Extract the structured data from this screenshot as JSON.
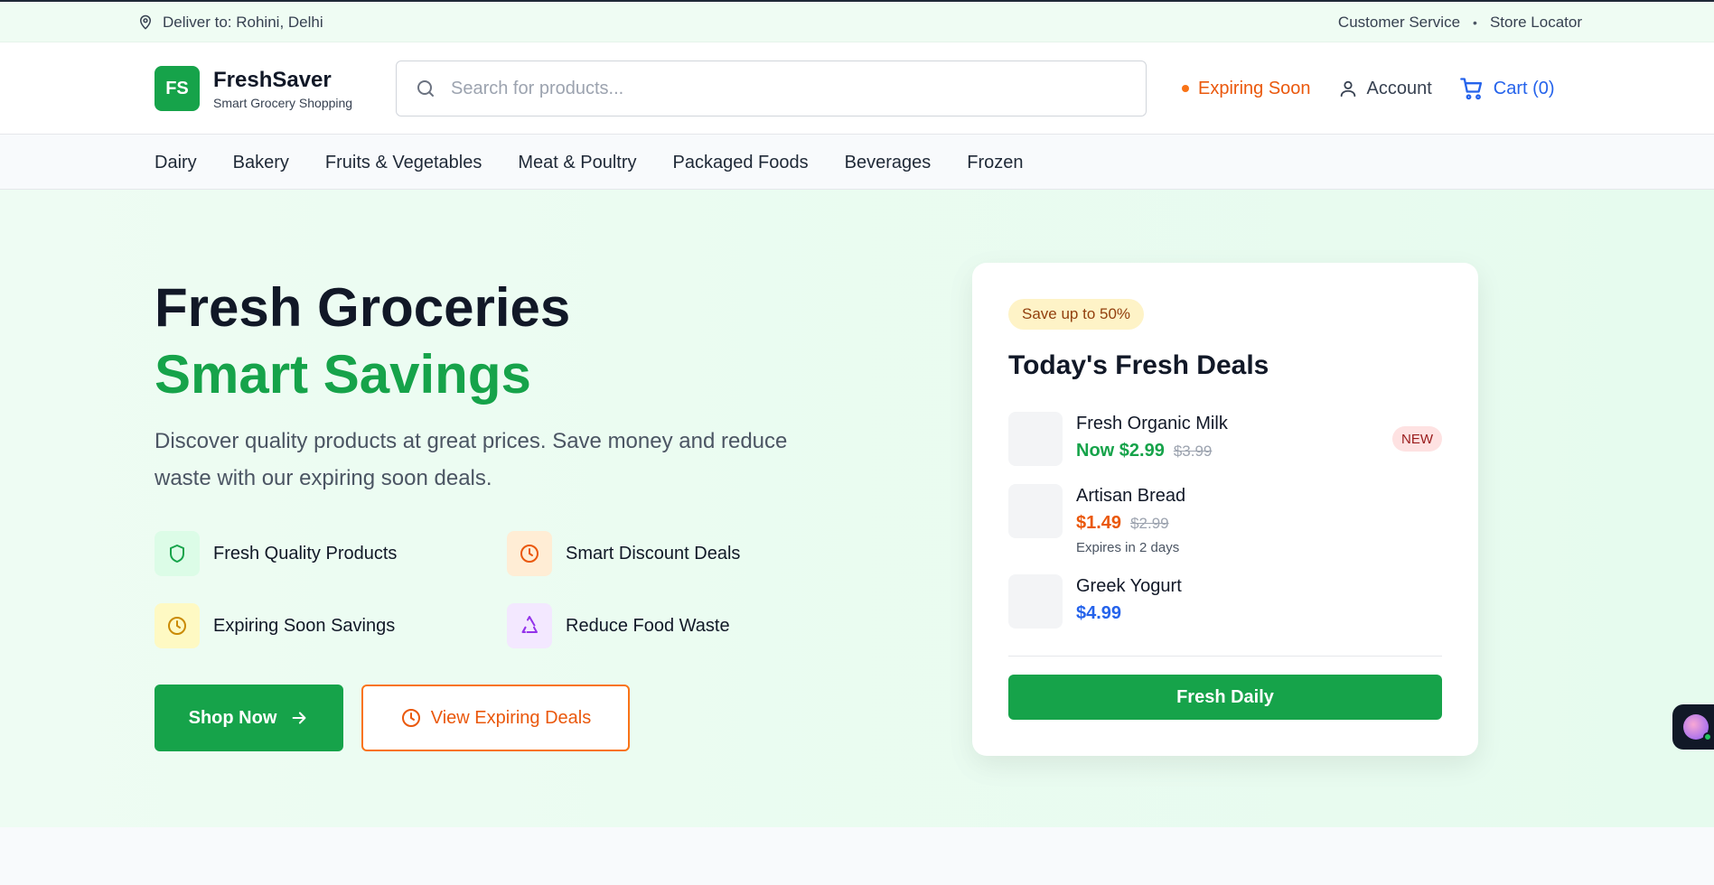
{
  "topbar": {
    "deliver_text": "Deliver to: Rohini, Delhi",
    "links": [
      "Customer Service",
      "Store Locator"
    ],
    "separator": "•"
  },
  "header": {
    "logo_initials": "FS",
    "brand_name": "FreshSaver",
    "brand_tagline": "Smart Grocery Shopping",
    "search_placeholder": "Search for products...",
    "expiring_soon_label": "Expiring Soon",
    "account_label": "Account",
    "cart_label": "Cart (0)"
  },
  "categories": [
    "Dairy",
    "Bakery",
    "Fruits & Vegetables",
    "Meat & Poultry",
    "Packaged Foods",
    "Beverages",
    "Frozen"
  ],
  "hero": {
    "title_line1": "Fresh Groceries",
    "title_line2": "Smart Savings",
    "description": "Discover quality products at great prices. Save money and reduce waste with our expiring soon deals.",
    "features": [
      {
        "label": "Fresh Quality Products",
        "icon": "shield-icon"
      },
      {
        "label": "Smart Discount Deals",
        "icon": "clock-icon"
      },
      {
        "label": "Expiring Soon Savings",
        "icon": "clock-icon"
      },
      {
        "label": "Reduce Food Waste",
        "icon": "recycle-icon"
      }
    ],
    "shop_now_label": "Shop Now",
    "view_expiring_label": "View Expiring Deals"
  },
  "deals_card": {
    "badge": "Save up to 50%",
    "title": "Today's Fresh Deals",
    "items": [
      {
        "name": "Fresh Organic Milk",
        "price": "Now $2.99",
        "old_price": "$3.99",
        "tag": "NEW"
      },
      {
        "name": "Artisan Bread",
        "price": "$1.49",
        "old_price": "$2.99",
        "note": "Expires in 2 days"
      },
      {
        "name": "Greek Yogurt",
        "price": "$4.99"
      }
    ],
    "button_label": "Fresh Daily"
  },
  "colors": {
    "brand_green": "#16a34a",
    "accent_orange": "#ea580c",
    "link_blue": "#2563eb",
    "hero_bg": "#e9fbf0"
  }
}
